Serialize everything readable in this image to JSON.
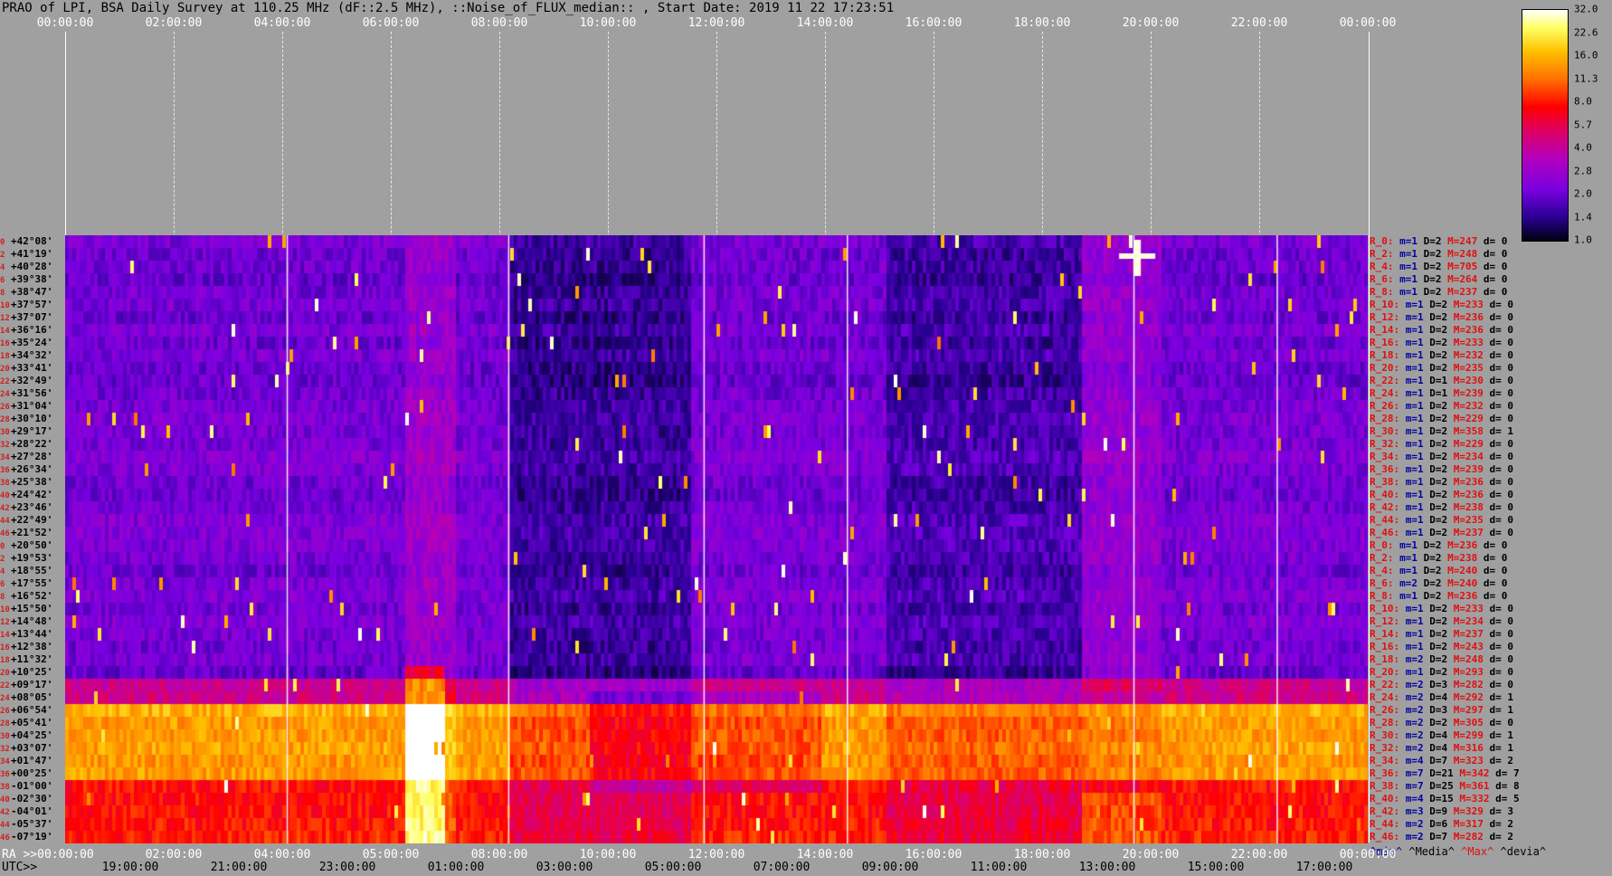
{
  "title": "PRAO of LPI, BSA Daily Survey at 110.25 MHz (dF::2.5 MHz), ::Noise_of_FLUX_median:: , Start Date: 2019 11 22 17:23:51",
  "top_ticks": [
    "00:00:00",
    "02:00:00",
    "04:00:00",
    "06:00:00",
    "08:00:00",
    "10:00:00",
    "12:00:00",
    "14:00:00",
    "16:00:00",
    "18:00:00",
    "20:00:00",
    "22:00:00",
    "00:00:00"
  ],
  "ra_label": "RA >>00:00:00",
  "ra_ticks": [
    "02:00:00",
    "04:00:00",
    "05:00:00",
    "08:00:00",
    "10:00:00",
    "12:00:00",
    "14:00:00",
    "16:00:00",
    "18:00:00",
    "20:00:00",
    "22:00:00",
    "00:00:00"
  ],
  "utc_label": "UTC>>",
  "utc_ticks": [
    "19:00:00",
    "21:00:00",
    "23:00:00",
    "01:00:00",
    "03:00:00",
    "05:00:00",
    "07:00:00",
    "09:00:00",
    "11:00:00",
    "13:00:00",
    "15:00:00",
    "17:00:00"
  ],
  "declinations": [
    {
      "idx": "0",
      "dec": "+42°08'"
    },
    {
      "idx": "2",
      "dec": "+41°19'"
    },
    {
      "idx": "4",
      "dec": "+40°28'"
    },
    {
      "idx": "6",
      "dec": "+39°38'"
    },
    {
      "idx": "8",
      "dec": "+38°47'"
    },
    {
      "idx": "10",
      "dec": "+37°57'"
    },
    {
      "idx": "12",
      "dec": "+37°07'"
    },
    {
      "idx": "14",
      "dec": "+36°16'"
    },
    {
      "idx": "16",
      "dec": "+35°24'"
    },
    {
      "idx": "18",
      "dec": "+34°32'"
    },
    {
      "idx": "20",
      "dec": "+33°41'"
    },
    {
      "idx": "22",
      "dec": "+32°49'"
    },
    {
      "idx": "24",
      "dec": "+31°56'"
    },
    {
      "idx": "26",
      "dec": "+31°04'"
    },
    {
      "idx": "28",
      "dec": "+30°10'"
    },
    {
      "idx": "30",
      "dec": "+29°17'"
    },
    {
      "idx": "32",
      "dec": "+28°22'"
    },
    {
      "idx": "34",
      "dec": "+27°28'"
    },
    {
      "idx": "36",
      "dec": "+26°34'"
    },
    {
      "idx": "38",
      "dec": "+25°38'"
    },
    {
      "idx": "40",
      "dec": "+24°42'"
    },
    {
      "idx": "42",
      "dec": "+23°46'"
    },
    {
      "idx": "44",
      "dec": "+22°49'"
    },
    {
      "idx": "46",
      "dec": "+21°52'"
    },
    {
      "idx": "0",
      "dec": "+20°50'"
    },
    {
      "idx": "2",
      "dec": "+19°53'"
    },
    {
      "idx": "4",
      "dec": "+18°55'"
    },
    {
      "idx": "6",
      "dec": "+17°55'"
    },
    {
      "idx": "8",
      "dec": "+16°52'"
    },
    {
      "idx": "10",
      "dec": "+15°50'"
    },
    {
      "idx": "12",
      "dec": "+14°48'"
    },
    {
      "idx": "14",
      "dec": "+13°44'"
    },
    {
      "idx": "16",
      "dec": "+12°38'"
    },
    {
      "idx": "18",
      "dec": "+11°32'"
    },
    {
      "idx": "20",
      "dec": "+10°25'"
    },
    {
      "idx": "22",
      "dec": "+09°17'"
    },
    {
      "idx": "24",
      "dec": "+08°05'"
    },
    {
      "idx": "26",
      "dec": "+06°54'"
    },
    {
      "idx": "28",
      "dec": "+05°41'"
    },
    {
      "idx": "30",
      "dec": "+04°25'"
    },
    {
      "idx": "32",
      "dec": "+03°07'"
    },
    {
      "idx": "34",
      "dec": "+01°47'"
    },
    {
      "idx": "36",
      "dec": "+00°25'"
    },
    {
      "idx": "38",
      "dec": "-01°00'"
    },
    {
      "idx": "40",
      "dec": "-02°30'"
    },
    {
      "idx": "42",
      "dec": "-04°01'"
    },
    {
      "idx": "44",
      "dec": "-05°37'"
    },
    {
      "idx": "46",
      "dec": "-07°19'"
    }
  ],
  "stats": [
    {
      "r": "R_0:",
      "m": "m=1",
      "D": "D=2",
      "M": "M=247",
      "d": "d= 0"
    },
    {
      "r": "R_2:",
      "m": "m=1",
      "D": "D=2",
      "M": "M=248",
      "d": "d= 0"
    },
    {
      "r": "R_4:",
      "m": "m=1",
      "D": "D=2",
      "M": "M=705",
      "d": "d= 0"
    },
    {
      "r": "R_6:",
      "m": "m=1",
      "D": "D=2",
      "M": "M=264",
      "d": "d= 0"
    },
    {
      "r": "R_8:",
      "m": "m=1",
      "D": "D=2",
      "M": "M=237",
      "d": "d= 0"
    },
    {
      "r": "R_10:",
      "m": "m=1",
      "D": "D=2",
      "M": "M=233",
      "d": "d= 0"
    },
    {
      "r": "R_12:",
      "m": "m=1",
      "D": "D=2",
      "M": "M=236",
      "d": "d= 0"
    },
    {
      "r": "R_14:",
      "m": "m=1",
      "D": "D=2",
      "M": "M=236",
      "d": "d= 0"
    },
    {
      "r": "R_16:",
      "m": "m=1",
      "D": "D=2",
      "M": "M=233",
      "d": "d= 0"
    },
    {
      "r": "R_18:",
      "m": "m=1",
      "D": "D=2",
      "M": "M=232",
      "d": "d= 0"
    },
    {
      "r": "R_20:",
      "m": "m=1",
      "D": "D=2",
      "M": "M=235",
      "d": "d= 0"
    },
    {
      "r": "R_22:",
      "m": "m=1",
      "D": "D=1",
      "M": "M=230",
      "d": "d= 0"
    },
    {
      "r": "R_24:",
      "m": "m=1",
      "D": "D=1",
      "M": "M=239",
      "d": "d= 0"
    },
    {
      "r": "R_26:",
      "m": "m=1",
      "D": "D=2",
      "M": "M=232",
      "d": "d= 0"
    },
    {
      "r": "R_28:",
      "m": "m=1",
      "D": "D=2",
      "M": "M=229",
      "d": "d= 0"
    },
    {
      "r": "R_30:",
      "m": "m=1",
      "D": "D=2",
      "M": "M=358",
      "d": "d= 1"
    },
    {
      "r": "R_32:",
      "m": "m=1",
      "D": "D=2",
      "M": "M=229",
      "d": "d= 0"
    },
    {
      "r": "R_34:",
      "m": "m=1",
      "D": "D=2",
      "M": "M=234",
      "d": "d= 0"
    },
    {
      "r": "R_36:",
      "m": "m=1",
      "D": "D=2",
      "M": "M=239",
      "d": "d= 0"
    },
    {
      "r": "R_38:",
      "m": "m=1",
      "D": "D=2",
      "M": "M=236",
      "d": "d= 0"
    },
    {
      "r": "R_40:",
      "m": "m=1",
      "D": "D=2",
      "M": "M=236",
      "d": "d= 0"
    },
    {
      "r": "R_42:",
      "m": "m=1",
      "D": "D=2",
      "M": "M=238",
      "d": "d= 0"
    },
    {
      "r": "R_44:",
      "m": "m=1",
      "D": "D=2",
      "M": "M=235",
      "d": "d= 0"
    },
    {
      "r": "R_46:",
      "m": "m=1",
      "D": "D=2",
      "M": "M=237",
      "d": "d= 0"
    },
    {
      "r": "R_0:",
      "m": "m=1",
      "D": "D=2",
      "M": "M=236",
      "d": "d= 0"
    },
    {
      "r": "R_2:",
      "m": "m=1",
      "D": "D=2",
      "M": "M=238",
      "d": "d= 0"
    },
    {
      "r": "R_4:",
      "m": "m=1",
      "D": "D=2",
      "M": "M=240",
      "d": "d= 0"
    },
    {
      "r": "R_6:",
      "m": "m=2",
      "D": "D=2",
      "M": "M=240",
      "d": "d= 0"
    },
    {
      "r": "R_8:",
      "m": "m=1",
      "D": "D=2",
      "M": "M=236",
      "d": "d= 0"
    },
    {
      "r": "R_10:",
      "m": "m=1",
      "D": "D=2",
      "M": "M=233",
      "d": "d= 0"
    },
    {
      "r": "R_12:",
      "m": "m=1",
      "D": "D=2",
      "M": "M=234",
      "d": "d= 0"
    },
    {
      "r": "R_14:",
      "m": "m=1",
      "D": "D=2",
      "M": "M=237",
      "d": "d= 0"
    },
    {
      "r": "R_16:",
      "m": "m=1",
      "D": "D=2",
      "M": "M=243",
      "d": "d= 0"
    },
    {
      "r": "R_18:",
      "m": "m=2",
      "D": "D=2",
      "M": "M=248",
      "d": "d= 0"
    },
    {
      "r": "R_20:",
      "m": "m=1",
      "D": "D=2",
      "M": "M=293",
      "d": "d= 0"
    },
    {
      "r": "R_22:",
      "m": "m=2",
      "D": "D=3",
      "M": "M=282",
      "d": "d= 0"
    },
    {
      "r": "R_24:",
      "m": "m=2",
      "D": "D=4",
      "M": "M=292",
      "d": "d= 1"
    },
    {
      "r": "R_26:",
      "m": "m=2",
      "D": "D=3",
      "M": "M=297",
      "d": "d= 1"
    },
    {
      "r": "R_28:",
      "m": "m=2",
      "D": "D=2",
      "M": "M=305",
      "d": "d= 0"
    },
    {
      "r": "R_30:",
      "m": "m=2",
      "D": "D=4",
      "M": "M=299",
      "d": "d= 1"
    },
    {
      "r": "R_32:",
      "m": "m=2",
      "D": "D=4",
      "M": "M=316",
      "d": "d= 1"
    },
    {
      "r": "R_34:",
      "m": "m=4",
      "D": "D=7",
      "M": "M=323",
      "d": "d= 2"
    },
    {
      "r": "R_36:",
      "m": "m=7",
      "D": "D=21",
      "M": "M=342",
      "d": "d= 7"
    },
    {
      "r": "R_38:",
      "m": "m=7",
      "D": "D=25",
      "M": "M=361",
      "d": "d= 8"
    },
    {
      "r": "R_40:",
      "m": "m=4",
      "D": "D=15",
      "M": "M=332",
      "d": "d= 5"
    },
    {
      "r": "R_42:",
      "m": "m=3",
      "D": "D=9",
      "M": "M=329",
      "d": "d= 3"
    },
    {
      "r": "R_44:",
      "m": "m=2",
      "D": "D=6",
      "M": "M=317",
      "d": "d= 2"
    },
    {
      "r": "R_46:",
      "m": "m=2",
      "D": "D=7",
      "M": "M=282",
      "d": "d= 2"
    }
  ],
  "legend": {
    "min": "^min^",
    "media": "^Media^",
    "max": "^Max^",
    "devia": "^devia^"
  },
  "colorbar_ticks": [
    "32.0",
    "22.6",
    "16.0",
    "11.3",
    "8.0",
    "5.7",
    "4.0",
    "2.8",
    "2.0",
    "1.4",
    "1.0"
  ],
  "colors": {
    "low": "#000010",
    "mid": "#9000d0",
    "high": "#ff0000",
    "peak": "#ffffff"
  }
}
